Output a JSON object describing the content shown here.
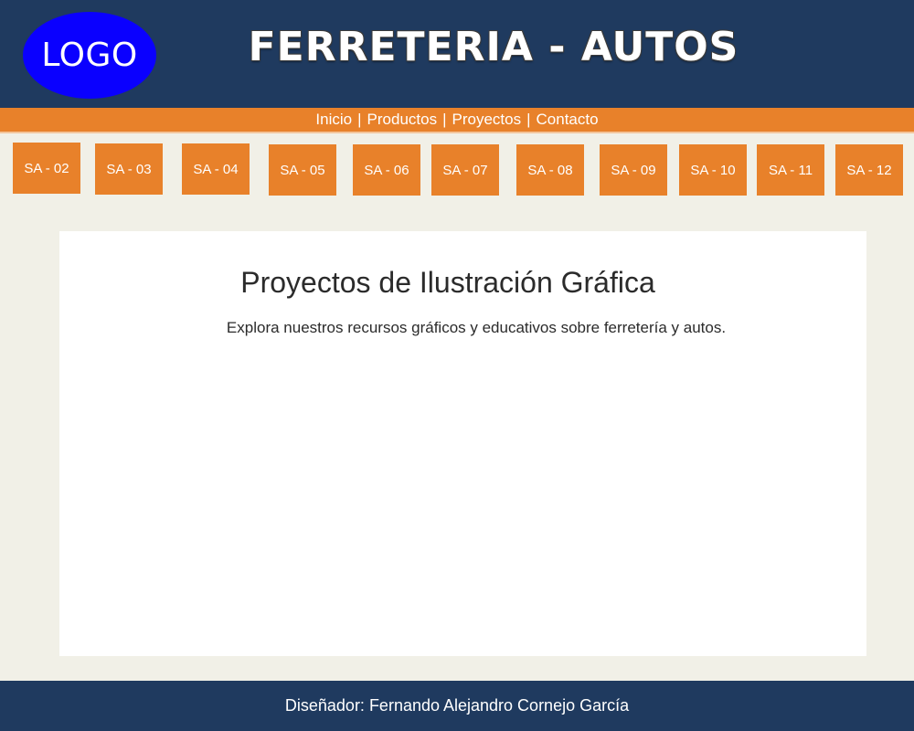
{
  "header": {
    "logo_text": "LOGO",
    "title": "FERRETERIA - AUTOS"
  },
  "nav": {
    "items": [
      "Inicio",
      "Productos",
      "Proyectos",
      "Contacto"
    ],
    "separator": "|"
  },
  "tiles": [
    "SA - 02",
    "SA - 03",
    "SA - 04",
    "SA - 05",
    "SA - 06",
    "SA - 07",
    "SA - 08",
    "SA - 09",
    "SA - 10",
    "SA - 11",
    "SA - 12"
  ],
  "main": {
    "title": "Proyectos de Ilustración Gráfica",
    "description": "Explora nuestros recursos gráficos y educativos sobre ferretería y autos."
  },
  "footer": {
    "credit": "Diseñador: Fernando Alejandro Cornejo García"
  },
  "colors": {
    "header_bg": "#1f3a5f",
    "accent_orange": "#e8812a",
    "logo_blue": "#0a00ff",
    "page_bg": "#f1f0e7"
  }
}
